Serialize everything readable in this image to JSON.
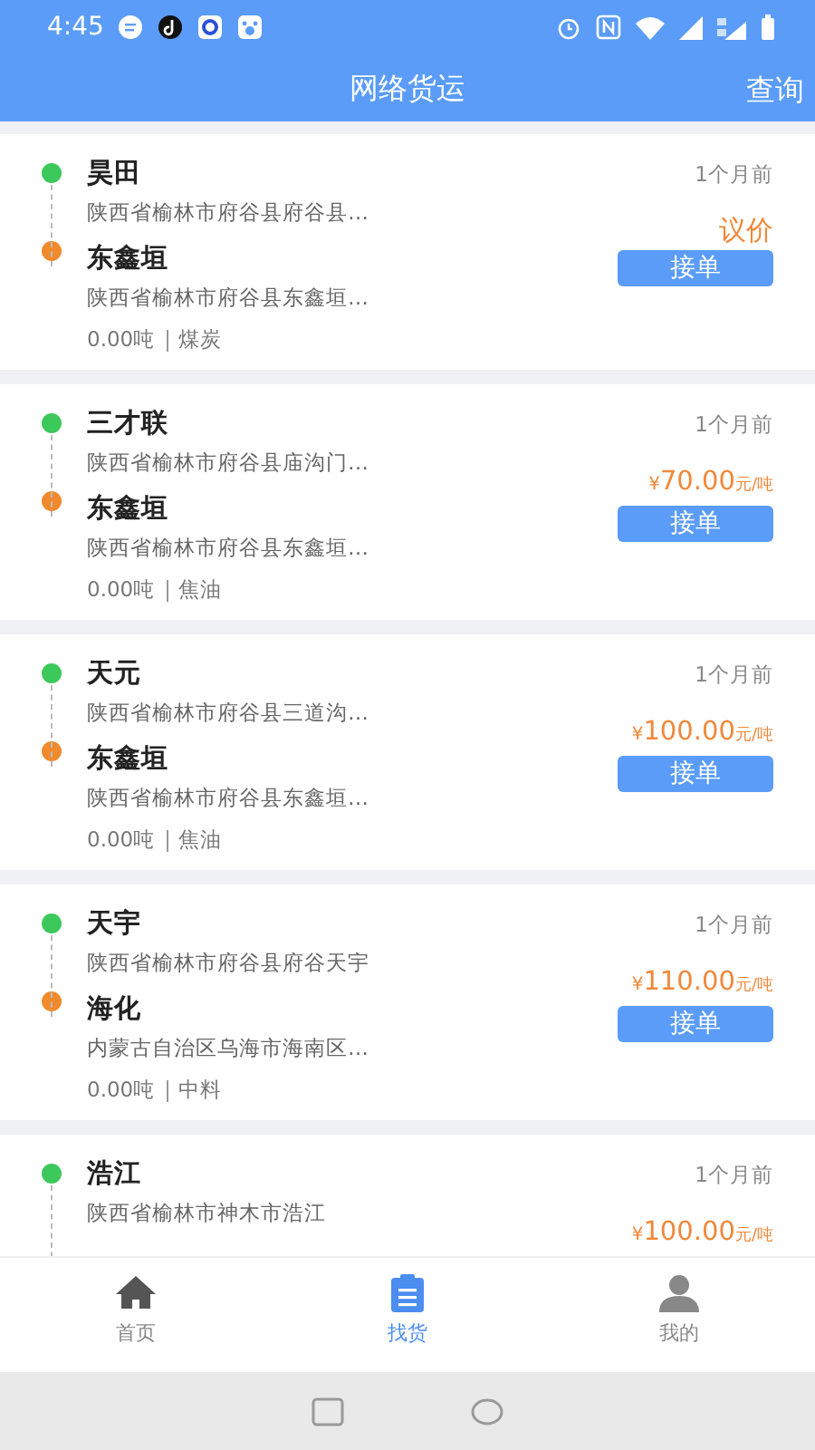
{
  "status_bar": {
    "time": "4:45"
  },
  "header": {
    "title": "网络货运",
    "action": "查询"
  },
  "orders": [
    {
      "from_name": "昊田",
      "from_address": "陕西省榆林市府谷县府谷县…",
      "to_name": "东鑫垣",
      "to_address": "陕西省榆林市府谷县东鑫垣…",
      "weight": "0.00吨",
      "cargo": "煤炭",
      "time": "1个月前",
      "price": {
        "kind": "negotiable",
        "text": "议价"
      },
      "button": "接单"
    },
    {
      "from_name": "三才联",
      "from_address": "陕西省榆林市府谷县庙沟门…",
      "to_name": "东鑫垣",
      "to_address": "陕西省榆林市府谷县东鑫垣…",
      "weight": "0.00吨",
      "cargo": "焦油",
      "time": "1个月前",
      "price": {
        "kind": "per_ton",
        "currency": "¥",
        "amount": "70.00",
        "unit": "元/吨"
      },
      "button": "接单"
    },
    {
      "from_name": "天元",
      "from_address": "陕西省榆林市府谷县三道沟…",
      "to_name": "东鑫垣",
      "to_address": "陕西省榆林市府谷县东鑫垣…",
      "weight": "0.00吨",
      "cargo": "焦油",
      "time": "1个月前",
      "price": {
        "kind": "per_ton",
        "currency": "¥",
        "amount": "100.00",
        "unit": "元/吨"
      },
      "button": "接单"
    },
    {
      "from_name": "天宇",
      "from_address": "陕西省榆林市府谷县府谷天宇",
      "to_name": "海化",
      "to_address": "内蒙古自治区乌海市海南区…",
      "weight": "0.00吨",
      "cargo": "中料",
      "time": "1个月前",
      "price": {
        "kind": "per_ton",
        "currency": "¥",
        "amount": "110.00",
        "unit": "元/吨"
      },
      "button": "接单"
    },
    {
      "from_name": "浩江",
      "from_address": "陕西省榆林市神木市浩江",
      "time": "1个月前",
      "price": {
        "kind": "per_ton",
        "currency": "¥",
        "amount": "100.00",
        "unit": "元/吨"
      }
    }
  ],
  "tabs": [
    {
      "label": "首页",
      "kind": "home",
      "selected": false
    },
    {
      "label": "找货",
      "kind": "clipboard",
      "selected": true
    },
    {
      "label": "我的",
      "kind": "person",
      "selected": false
    }
  ]
}
